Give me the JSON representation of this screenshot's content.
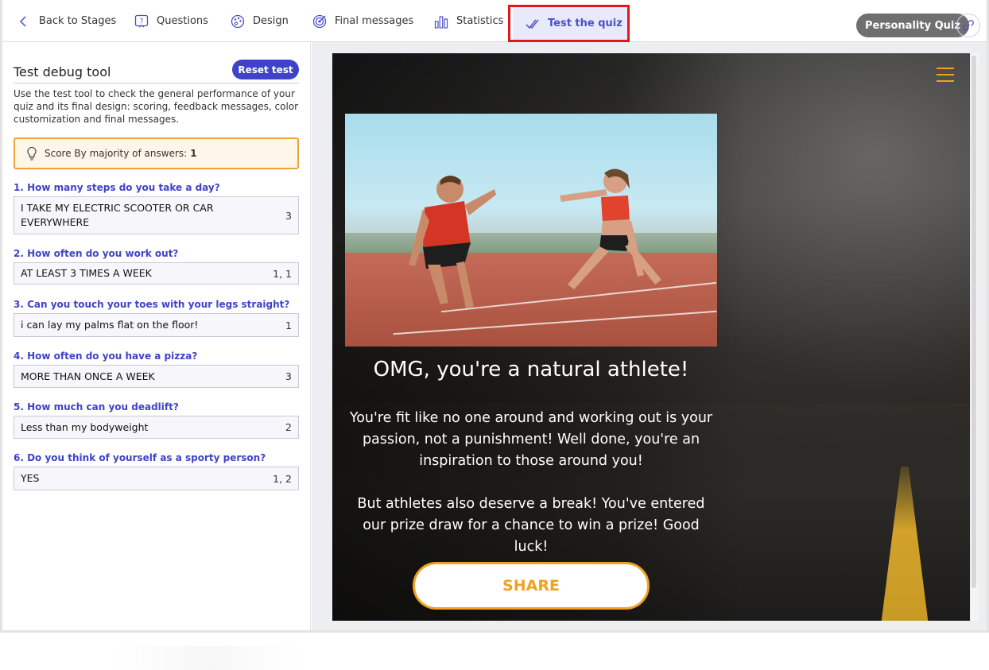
{
  "nav": {
    "back": "Back to Stages",
    "questions": "Questions",
    "design": "Design",
    "final_messages": "Final messages",
    "statistics": "Statistics",
    "test": "Test the quiz",
    "quiz_type": "Personality Quiz"
  },
  "left": {
    "title": "Test debug tool",
    "reset": "Reset test",
    "description": "Use the test tool to check the general performance of your quiz and its final design: scoring, feedback messages, color customization and final messages.",
    "score_label": "Score By majority of answers:",
    "score_value": "1",
    "questions": [
      {
        "q": "1. How many steps do you take a day?",
        "a": "I TAKE MY ELECTRIC SCOOTER OR CAR EVERYWHERE",
        "v": "3"
      },
      {
        "q": "2. How often do you work out?",
        "a": "AT LEAST 3 TIMES A WEEK",
        "v": "1, 1"
      },
      {
        "q": "3. Can you touch your toes with your legs straight?",
        "a": "i can lay my palms flat on the floor!",
        "v": "1"
      },
      {
        "q": "4. How often do you have a pizza?",
        "a": "MORE THAN ONCE A WEEK",
        "v": "3"
      },
      {
        "q": "5. How much can you deadlift?",
        "a": "Less than my bodyweight",
        "v": "2"
      },
      {
        "q": "6. Do you think of yourself as a sporty person?",
        "a": "YES",
        "v": "1, 2"
      }
    ]
  },
  "preview": {
    "title": "OMG, you're a natural athlete!",
    "body1": "You're fit like no one around and working out is your passion, not a punishment! Well done, you're an inspiration to those around you!",
    "body2": "But athletes also deserve a break! You've entered our prize draw for a chance to win a prize! Good luck!",
    "share": "SHARE"
  },
  "colors": {
    "accent": "#3f43c9",
    "active_tab_bg": "#e8e9fb",
    "highlight": "#e5161b",
    "cta": "#f0a21f"
  }
}
